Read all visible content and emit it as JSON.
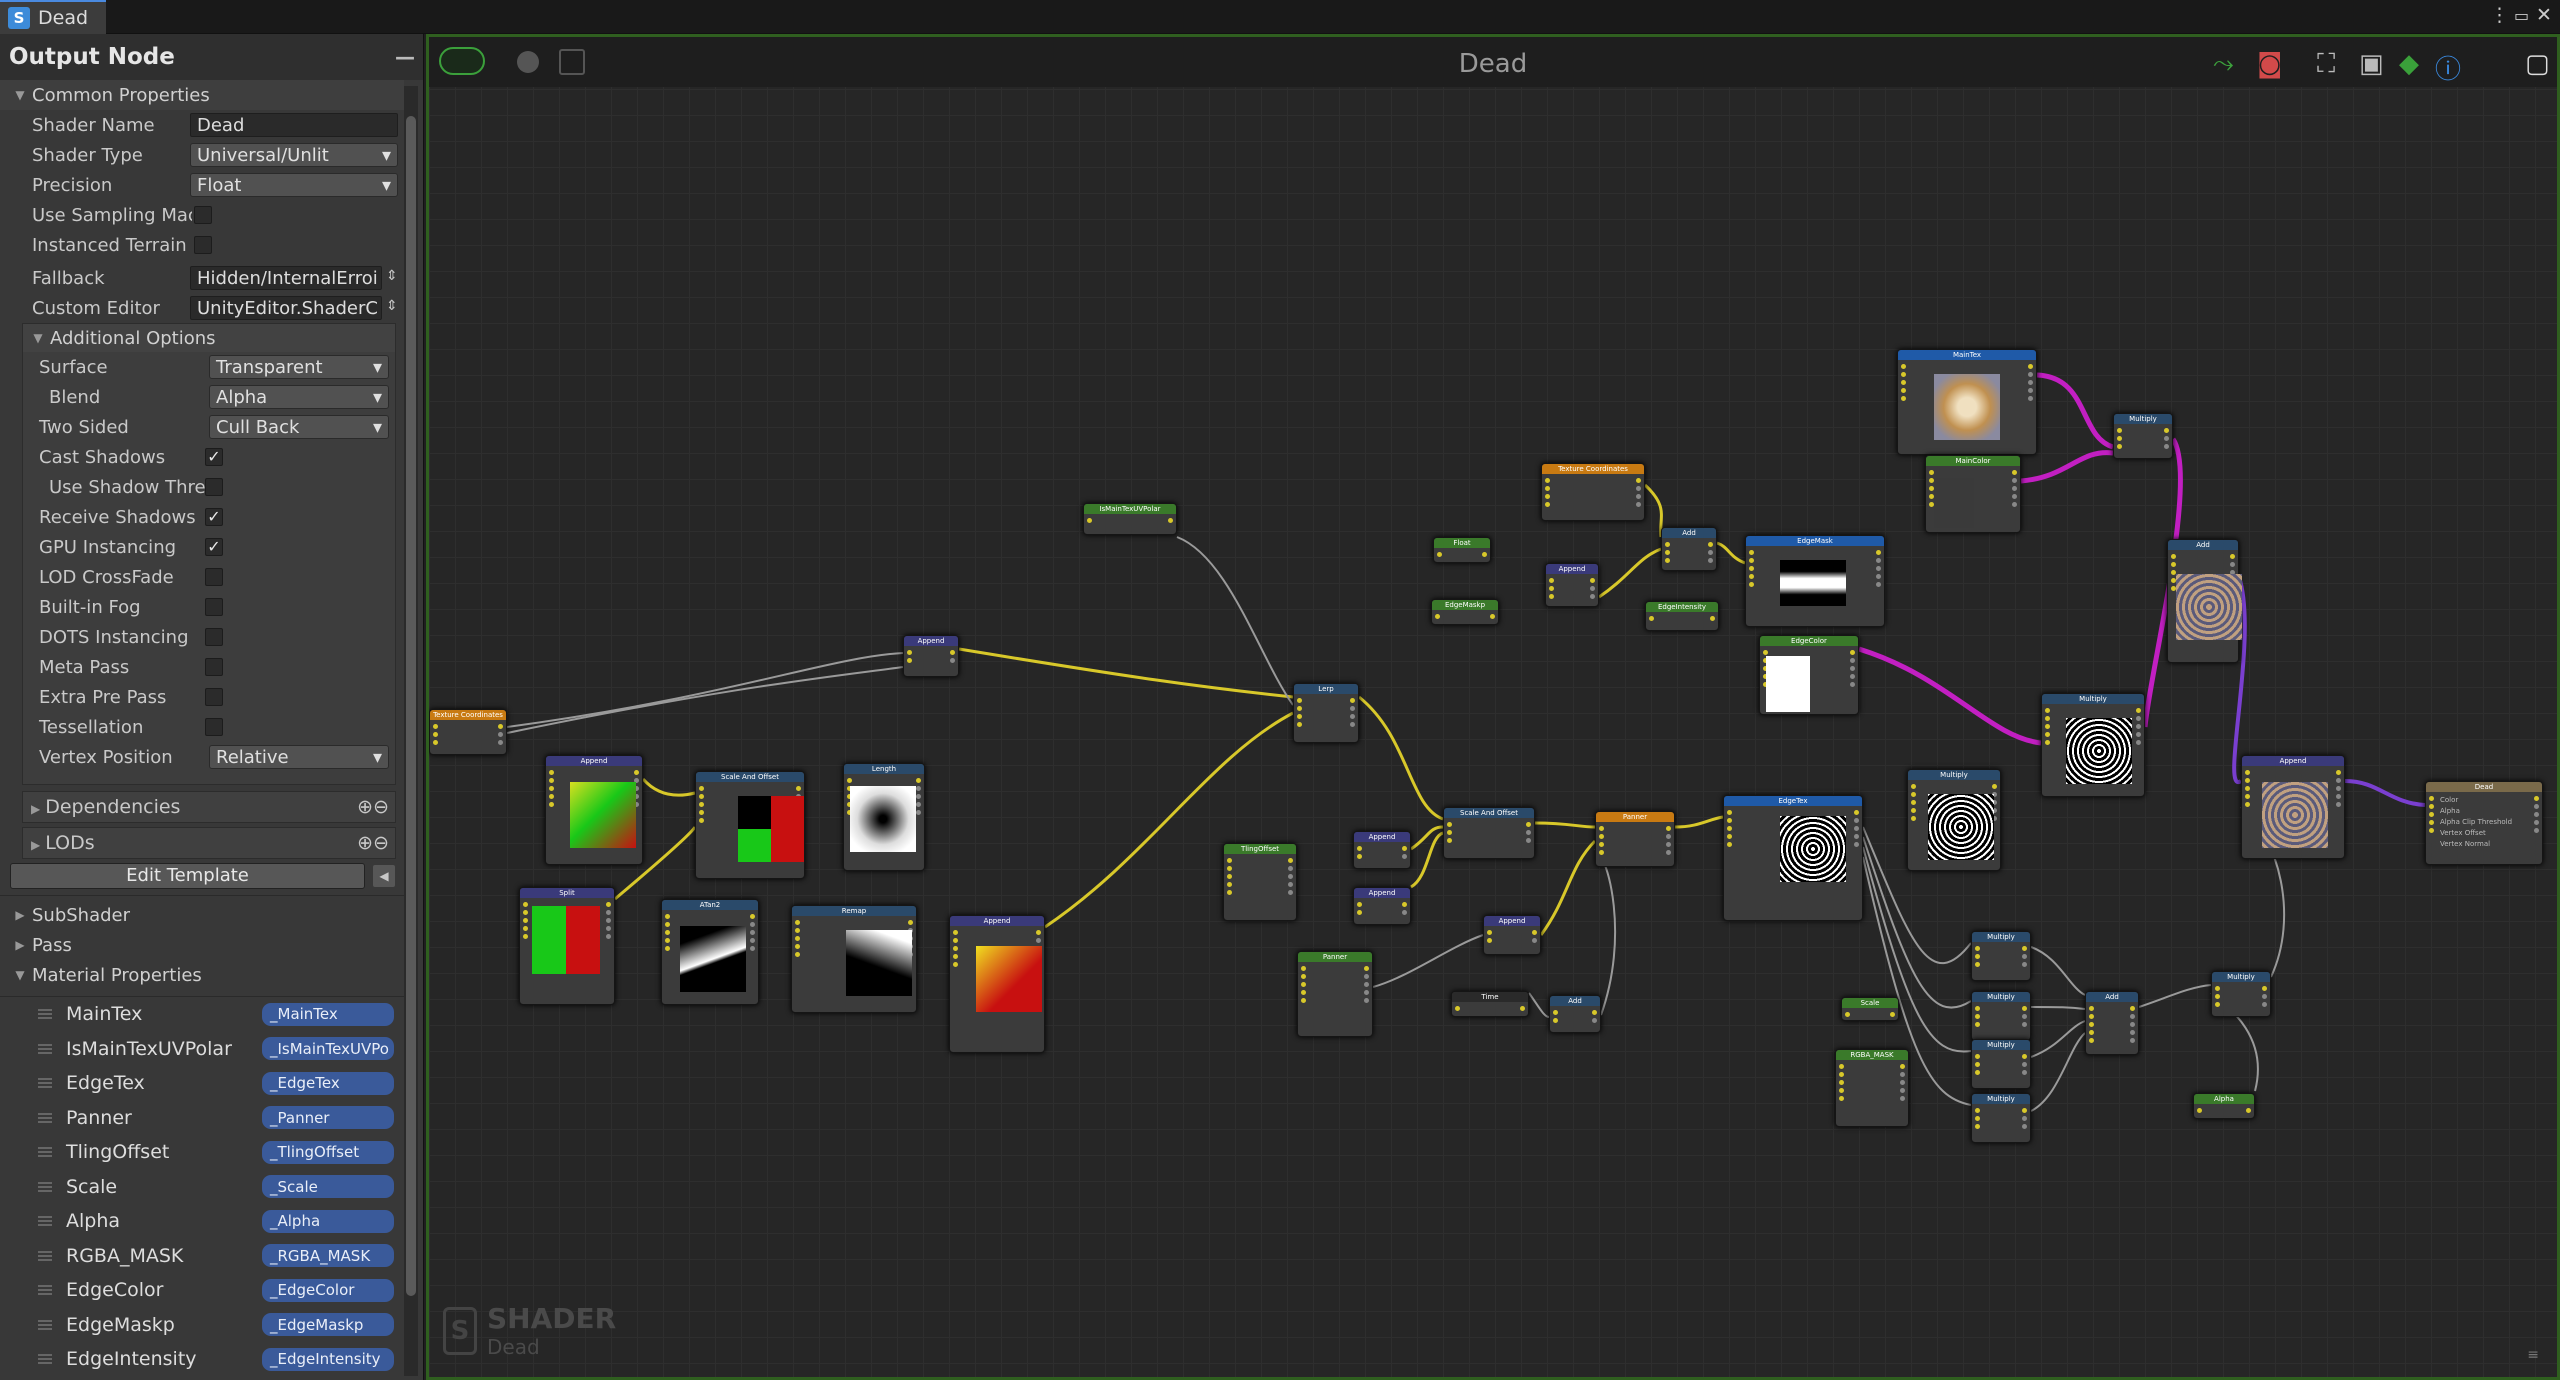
{
  "window": {
    "tab_title": "Dead",
    "app_icon": "S",
    "menu_icon": "more-vert-icon",
    "max_icon": "maximize-icon",
    "close_icon": "close-icon"
  },
  "panel": {
    "title": "Output Node",
    "collapse": "—"
  },
  "common": {
    "header": "Common Properties",
    "shader_name_label": "Shader Name",
    "shader_name": "Dead",
    "shader_type_label": "Shader Type",
    "shader_type": "Universal/Unlit",
    "precision_label": "Precision",
    "precision": "Float",
    "use_sampling_label": "Use Sampling Mac",
    "instanced_terrain_label": "Instanced Terrain",
    "fallback_label": "Fallback",
    "fallback": "Hidden/InternalErroi",
    "custom_editor_label": "Custom Editor",
    "custom_editor": "UnityEditor.ShaderC"
  },
  "additional": {
    "header": "Additional Options",
    "surface_label": "Surface",
    "surface": "Transparent",
    "blend_label": "Blend",
    "blend": "Alpha",
    "two_sided_label": "Two Sided",
    "two_sided": "Cull Back",
    "cast_shadows_label": "Cast Shadows",
    "use_shadow_label": "Use Shadow Thre",
    "receive_shadows_label": "Receive Shadows",
    "gpu_inst_label": "GPU Instancing",
    "lod_label": "LOD CrossFade",
    "fog_label": "Built-in Fog",
    "dots_label": "DOTS Instancing",
    "meta_label": "Meta Pass",
    "extra_label": "Extra Pre Pass",
    "tess_label": "Tessellation",
    "vertex_pos_label": "Vertex Position",
    "vertex_pos": "Relative"
  },
  "dependencies": "Dependencies",
  "lods": "LODs",
  "edit_template": "Edit Template",
  "subshader": "SubShader",
  "pass": "Pass",
  "material_props": "Material Properties",
  "props": [
    {
      "name": "MainTex",
      "ref": "_MainTex"
    },
    {
      "name": "IsMainTexUVPolar",
      "ref": "_IsMainTexUVPo"
    },
    {
      "name": "EdgeTex",
      "ref": "_EdgeTex"
    },
    {
      "name": "Panner",
      "ref": "_Panner"
    },
    {
      "name": "TlingOffset",
      "ref": "_TlingOffset"
    },
    {
      "name": "Scale",
      "ref": "_Scale"
    },
    {
      "name": "Alpha",
      "ref": "_Alpha"
    },
    {
      "name": "RGBA_MASK",
      "ref": "_RGBA_MASK"
    },
    {
      "name": "EdgeColor",
      "ref": "_EdgeColor"
    },
    {
      "name": "EdgeMaskp",
      "ref": "_EdgeMaskp"
    },
    {
      "name": "EdgeIntensity",
      "ref": "_EdgeIntensity"
    }
  ],
  "canvas": {
    "title": "Dead",
    "watermark_title": "SHADER",
    "watermark_sub": "Dead"
  },
  "colors": {
    "accent": "#4a8ae0",
    "frame": "#2f5f1f",
    "yellow_wire": "#d8c82a",
    "magenta_wire": "#c21fc2",
    "purple_wire": "#7a3fd0"
  },
  "nodes": [
    {
      "id": "n1",
      "label": "Texture Coordinates",
      "color": "#c87a12"
    },
    {
      "id": "n2",
      "label": "Append",
      "color": "#3a3a7a"
    },
    {
      "id": "n3",
      "label": "Split",
      "color": "#3a3a7a"
    },
    {
      "id": "n4",
      "label": "Scale And Offset",
      "color": "#2a4a6a"
    },
    {
      "id": "n5",
      "label": "ATan2",
      "color": "#2a4a6a"
    },
    {
      "id": "n6",
      "label": "Length",
      "color": "#2a4a6a"
    },
    {
      "id": "n7",
      "label": "Remap",
      "color": "#2a4a6a"
    },
    {
      "id": "n8",
      "label": "Append",
      "color": "#3a3a7a"
    },
    {
      "id": "n9",
      "label": "Append",
      "color": "#3a3a7a"
    },
    {
      "id": "n10",
      "label": "IsMainTexUVPolar",
      "color": "#3a7a2a"
    },
    {
      "id": "n11",
      "label": "Lerp",
      "color": "#2a4a6a"
    },
    {
      "id": "n12",
      "label": "TlingOffset",
      "color": "#3a7a2a"
    },
    {
      "id": "n13",
      "label": "Append",
      "color": "#3a3a7a"
    },
    {
      "id": "n14",
      "label": "Append",
      "color": "#3a3a7a"
    },
    {
      "id": "n15",
      "label": "Scale And Offset",
      "color": "#2a4a6a"
    },
    {
      "id": "n16",
      "label": "Panner",
      "color": "#3a7a2a"
    },
    {
      "id": "n17",
      "label": "Time",
      "color": "#2a2a2a"
    },
    {
      "id": "n18",
      "label": "Append",
      "color": "#3a3a7a"
    },
    {
      "id": "n19",
      "label": "Add",
      "color": "#2a4a6a"
    },
    {
      "id": "n20",
      "label": "Panner",
      "color": "#c87a12"
    },
    {
      "id": "n21",
      "label": "EdgeTex",
      "color": "#1f5aa8"
    },
    {
      "id": "n22",
      "label": "Texture Coordinates",
      "color": "#c87a12"
    },
    {
      "id": "n23",
      "label": "Float",
      "color": "#3a7a2a"
    },
    {
      "id": "n24",
      "label": "EdgeMaskp",
      "color": "#3a7a2a"
    },
    {
      "id": "n25",
      "label": "Append",
      "color": "#3a3a7a"
    },
    {
      "id": "n26",
      "label": "Add",
      "color": "#2a4a6a"
    },
    {
      "id": "n27",
      "label": "EdgeMask",
      "color": "#1f5aa8"
    },
    {
      "id": "n28",
      "label": "EdgeIntensity",
      "color": "#3a7a2a"
    },
    {
      "id": "n29",
      "label": "EdgeColor",
      "color": "#3a7a2a"
    },
    {
      "id": "n30",
      "label": "MainTex",
      "color": "#1f5aa8"
    },
    {
      "id": "n31",
      "label": "MainColor",
      "color": "#3a7a2a"
    },
    {
      "id": "n32",
      "label": "Multiply",
      "color": "#2a4a6a"
    },
    {
      "id": "n33",
      "label": "Add",
      "color": "#2a4a6a"
    },
    {
      "id": "n34",
      "label": "Multiply",
      "color": "#2a4a6a"
    },
    {
      "id": "n35",
      "label": "Multiply",
      "color": "#2a4a6a"
    },
    {
      "id": "n36",
      "label": "Append",
      "color": "#3a3a7a"
    },
    {
      "id": "n37",
      "label": "Dead",
      "color": "#7a6a4a"
    },
    {
      "id": "n38",
      "label": "Scale",
      "color": "#3a7a2a"
    },
    {
      "id": "n39",
      "label": "RGBA_MASK",
      "color": "#3a7a2a"
    },
    {
      "id": "n40",
      "label": "Multiply",
      "color": "#2a4a6a"
    },
    {
      "id": "n41",
      "label": "Multiply",
      "color": "#2a4a6a"
    },
    {
      "id": "n42",
      "label": "Multiply",
      "color": "#2a4a6a"
    },
    {
      "id": "n43",
      "label": "Multiply",
      "color": "#2a4a6a"
    },
    {
      "id": "n44",
      "label": "Add",
      "color": "#2a4a6a"
    },
    {
      "id": "n45",
      "label": "Multiply",
      "color": "#2a4a6a"
    },
    {
      "id": "n46",
      "label": "Alpha",
      "color": "#3a7a2a"
    }
  ],
  "output_ports": [
    "Color",
    "Alpha",
    "Alpha Clip Threshold",
    "Vertex Offset",
    "Vertex Normal"
  ]
}
